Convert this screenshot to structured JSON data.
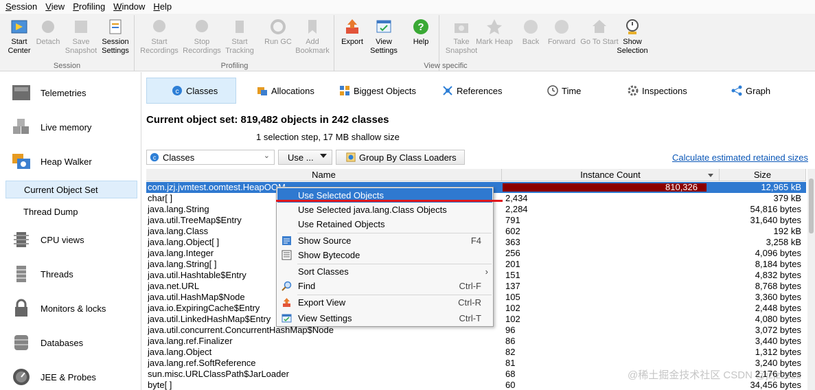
{
  "menubar": [
    "Session",
    "View",
    "Profiling",
    "Window",
    "Help"
  ],
  "toolbar": {
    "groups": [
      {
        "label": "Session",
        "buttons": [
          {
            "label": "Start Center",
            "icon": "start-center-icon",
            "enabled": true
          },
          {
            "label": "Detach",
            "icon": "detach-icon",
            "enabled": false
          },
          {
            "label": "Save Snapshot",
            "icon": "save-icon",
            "enabled": false
          },
          {
            "label": "Session Settings",
            "icon": "session-settings-icon",
            "enabled": true
          }
        ]
      },
      {
        "label": "Profiling",
        "buttons": [
          {
            "label": "Start Recordings",
            "icon": "start-recordings-icon",
            "enabled": false
          },
          {
            "label": "Stop Recordings",
            "icon": "stop-recordings-icon",
            "enabled": false
          },
          {
            "label": "Start Tracking",
            "icon": "start-tracking-icon",
            "enabled": false
          },
          {
            "label": "Run GC",
            "icon": "run-gc-icon",
            "enabled": false
          },
          {
            "label": "Add Bookmark",
            "icon": "bookmark-icon",
            "enabled": false
          }
        ]
      },
      {
        "label": "",
        "buttons": [
          {
            "label": "Export",
            "icon": "export-icon",
            "enabled": true
          },
          {
            "label": "View Settings",
            "icon": "view-settings-icon",
            "enabled": true
          },
          {
            "label": "Help",
            "icon": "help-icon",
            "enabled": true
          }
        ]
      },
      {
        "label": "View specific",
        "buttons": [
          {
            "label": "Take Snapshot",
            "icon": "camera-icon",
            "enabled": false
          },
          {
            "label": "Mark Heap",
            "icon": "pin-icon",
            "enabled": false
          },
          {
            "label": "Back",
            "icon": "back-icon",
            "enabled": false
          },
          {
            "label": "Forward",
            "icon": "forward-icon",
            "enabled": false
          },
          {
            "label": "Go To Start",
            "icon": "home-icon",
            "enabled": false
          },
          {
            "label": "Show Selection",
            "icon": "show-selection-icon",
            "enabled": true
          }
        ]
      }
    ]
  },
  "nav": {
    "items": [
      {
        "label": "Telemetries",
        "icon": "telemetries-icon"
      },
      {
        "label": "Live memory",
        "icon": "live-memory-icon"
      },
      {
        "label": "Heap Walker",
        "icon": "heap-walker-icon"
      },
      {
        "label": "Current Object Set",
        "sub": true,
        "selected": true
      },
      {
        "label": "Thread Dump",
        "sub": true
      },
      {
        "label": "CPU views",
        "icon": "cpu-icon"
      },
      {
        "label": "Threads",
        "icon": "threads-icon"
      },
      {
        "label": "Monitors & locks",
        "icon": "lock-icon"
      },
      {
        "label": "Databases",
        "icon": "database-icon"
      },
      {
        "label": "JEE & Probes",
        "icon": "probe-icon"
      }
    ]
  },
  "tabs": [
    {
      "label": "Classes",
      "icon": "classes-icon",
      "selected": true
    },
    {
      "label": "Allocations",
      "icon": "allocations-icon"
    },
    {
      "label": "Biggest Objects",
      "icon": "biggest-objects-icon"
    },
    {
      "label": "References",
      "icon": "references-icon"
    },
    {
      "label": "Time",
      "icon": "clock-icon"
    },
    {
      "label": "Inspections",
      "icon": "inspections-icon"
    },
    {
      "label": "Graph",
      "icon": "graph-icon"
    }
  ],
  "object_set": {
    "title": "Current object set:  819,482 objects in 242 classes",
    "subtitle": "1 selection step, 17 MB shallow size"
  },
  "controls": {
    "view_select": "Classes",
    "use_button": "Use ...",
    "group_button": "Group By Class Loaders",
    "calc_link": "Calculate estimated retained sizes"
  },
  "table": {
    "columns": [
      "Name",
      "Instance Count",
      "Size"
    ],
    "rows": [
      {
        "name": "com.jzj.jvmtest.oomtest.HeapOOM",
        "count": "810,326",
        "size": "12,965 kB",
        "fraction": 0.989,
        "selected": true
      },
      {
        "name": "char[ ]",
        "count": "2,434",
        "size": "379 kB"
      },
      {
        "name": "java.lang.String",
        "count": "2,284",
        "size": "54,816 bytes"
      },
      {
        "name": "java.util.TreeMap$Entry",
        "count": "791",
        "size": "31,640 bytes"
      },
      {
        "name": "java.lang.Class",
        "count": "602",
        "size": "192 kB"
      },
      {
        "name": "java.lang.Object[ ]",
        "count": "363",
        "size": "3,258 kB"
      },
      {
        "name": "java.lang.Integer",
        "count": "256",
        "size": "4,096 bytes"
      },
      {
        "name": "java.lang.String[ ]",
        "count": "201",
        "size": "8,184 bytes"
      },
      {
        "name": "java.util.Hashtable$Entry",
        "count": "151",
        "size": "4,832 bytes"
      },
      {
        "name": "java.net.URL",
        "count": "137",
        "size": "8,768 bytes"
      },
      {
        "name": "java.util.HashMap$Node",
        "count": "105",
        "size": "3,360 bytes"
      },
      {
        "name": "java.io.ExpiringCache$Entry",
        "count": "102",
        "size": "2,448 bytes"
      },
      {
        "name": "java.util.LinkedHashMap$Entry",
        "count": "102",
        "size": "4,080 bytes"
      },
      {
        "name": "java.util.concurrent.ConcurrentHashMap$Node",
        "count": "96",
        "size": "3,072 bytes"
      },
      {
        "name": "java.lang.ref.Finalizer",
        "count": "86",
        "size": "3,440 bytes"
      },
      {
        "name": "java.lang.Object",
        "count": "82",
        "size": "1,312 bytes"
      },
      {
        "name": "java.lang.ref.SoftReference",
        "count": "81",
        "size": "3,240 bytes"
      },
      {
        "name": "sun.misc.URLClassPath$JarLoader",
        "count": "68",
        "size": "2,176 bytes"
      },
      {
        "name": "byte[ ]",
        "count": "60",
        "size": "34,456 bytes"
      }
    ]
  },
  "context_menu": {
    "items": [
      {
        "label": "Use Selected Objects",
        "highlight": true
      },
      {
        "label": "Use Selected java.lang.Class Objects"
      },
      {
        "label": "Use Retained Objects"
      },
      {
        "sep": true
      },
      {
        "label": "Show Source",
        "shortcut": "F4",
        "icon": "source-icon"
      },
      {
        "label": "Show Bytecode",
        "icon": "bytecode-icon"
      },
      {
        "sep": true
      },
      {
        "label": "Sort Classes",
        "submenu": true
      },
      {
        "label": "Find",
        "shortcut": "Ctrl-F",
        "icon": "find-icon"
      },
      {
        "sep": true
      },
      {
        "label": "Export View",
        "shortcut": "Ctrl-R",
        "icon": "export-icon"
      },
      {
        "label": "View Settings",
        "shortcut": "Ctrl-T",
        "icon": "view-settings-icon"
      }
    ]
  },
  "watermark": "@稀土掘金技术社区 CSDN @jzjzzzzz",
  "colors": {
    "selection": "#2f79d0",
    "bar": "#8b0000",
    "link": "#0b57b7",
    "underline": "#e0161c"
  }
}
